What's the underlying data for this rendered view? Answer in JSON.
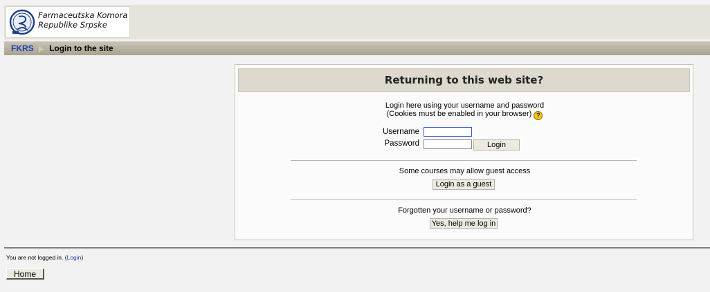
{
  "header": {
    "logo_line1": "Farmaceutska Komora",
    "logo_line2": "Republike Srpske"
  },
  "breadcrumb": {
    "home": "FKRS",
    "separator": "▶",
    "current": "Login to the site"
  },
  "login": {
    "heading": "Returning to this web site?",
    "intro_line1": "Login here using your username and password",
    "intro_line2": "(Cookies must be enabled in your browser)",
    "help_icon": "?",
    "username_label": "Username",
    "password_label": "Password",
    "username_value": "",
    "password_value": "",
    "login_button": "Login",
    "guest_text": "Some courses may allow guest access",
    "guest_button": "Login as a guest",
    "forgot_text": "Forgotten your username or password?",
    "forgot_button": "Yes, help me log in"
  },
  "footer": {
    "status_prefix": "You are not logged in. (",
    "status_link": "Login",
    "status_suffix": ")",
    "home_button": "Home"
  }
}
